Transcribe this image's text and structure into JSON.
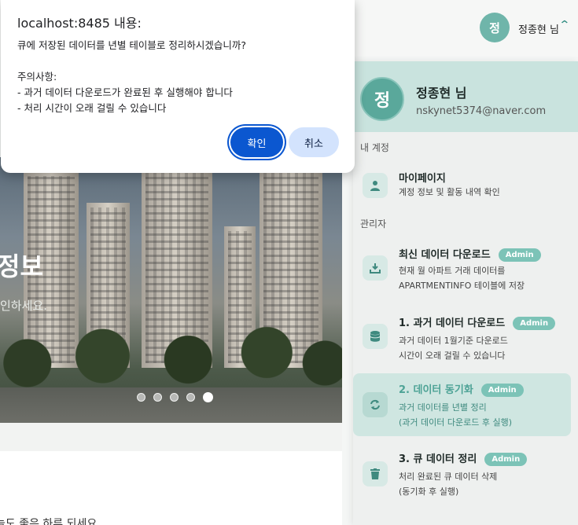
{
  "dialog": {
    "title": "localhost:8485 내용:",
    "message": "큐에 저장된 데이터를 년별 테이블로 정리하시겠습니까?\n\n주의사항:\n- 과거 데이터 다운로드가 완료된 후 실행해야 합니다\n- 처리 시간이 오래 걸릴 수 있습니다",
    "ok_label": "확인",
    "cancel_label": "취소"
  },
  "header": {
    "avatar_initial": "정",
    "user_name": "정종현 님",
    "chevron": "^"
  },
  "hero": {
    "title": "정보",
    "subtitle": "인하세요.",
    "slide_count": 5,
    "active_slide": 5
  },
  "greeting": "늘도 좋은 하루 되세요.",
  "panel": {
    "profile": {
      "initial": "정",
      "name": "정종현 님",
      "email": "nskynet5374@naver.com"
    },
    "section_account": "내 계정",
    "section_admin": "관리자",
    "items": [
      {
        "title": "마이페이지",
        "desc": [
          "계정 정보 및 활동 내역 확인"
        ],
        "icon": "person-icon",
        "badge": ""
      },
      {
        "title": "최신 데이터 다운로드",
        "desc": [
          "현재 월 아파트 거래 데이터를",
          "APARTMENTINFO 테이블에 저장"
        ],
        "icon": "download-icon",
        "badge": "Admin"
      },
      {
        "title": "1. 과거 데이터 다운로드",
        "desc": [
          "과거 데이터 1월기준 다운로드",
          "시간이 오래 걸릴 수 있습니다"
        ],
        "icon": "database-icon",
        "badge": "Admin"
      },
      {
        "title": "2. 데이터 동기화",
        "desc": [
          "과거 데이터를 년별 정리",
          "(과거 데이터 다운로드 후 실행)"
        ],
        "icon": "sync-icon",
        "badge": "Admin"
      },
      {
        "title": "3. 큐 데이터 정리",
        "desc": [
          "처리 완료된 큐 데이터 삭제",
          "(동기화 후 실행)"
        ],
        "icon": "trash-icon",
        "badge": "Admin"
      }
    ]
  },
  "colors": {
    "accent": "#5aa89b",
    "badge": "#7cc3b7",
    "dialog_ok": "#0b57d0",
    "dialog_cancel": "#d3e3fd"
  }
}
